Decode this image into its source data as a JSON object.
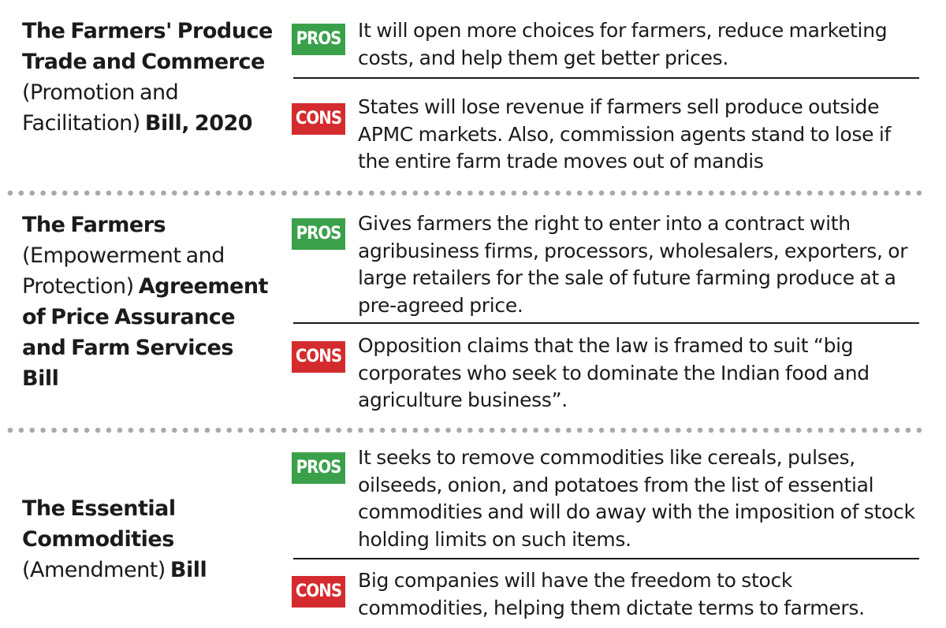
{
  "bills": [
    {
      "title_parts": [
        {
          "text": "The Farmers' Produce Trade and Commerce",
          "bold": true
        },
        {
          "text": " (Promotion and Facilitation) ",
          "bold": false
        },
        {
          "text": "Bill, 2020",
          "bold": true
        }
      ],
      "pros_label": "PROS",
      "pros_text": "It will open more choices for farmers, reduce marketing costs, and help them get better prices.",
      "cons_label": "CONS",
      "cons_text": "States will lose revenue if farmers sell produce outside APMC markets. Also, commission agents stand to lose if the entire farm trade moves out of mandis"
    },
    {
      "title_parts": [
        {
          "text": "The Farmers",
          "bold": true
        },
        {
          "text": " (Empowerment and Protection) ",
          "bold": false
        },
        {
          "text": "Agreement of Price Assurance and Farm Services Bill",
          "bold": true
        }
      ],
      "pros_label": "PROS",
      "pros_text": "Gives farmers the right to enter into a contract with agribusiness firms, processors, wholesalers, exporters, or large retailers for the sale of future farming produce at a pre-agreed price.",
      "cons_label": "CONS",
      "cons_text": "Opposition claims that the law is framed to suit “big corporates who seek to dominate the Indian food and agriculture business”."
    },
    {
      "title_parts": [
        {
          "text": "The Essential Commodities",
          "bold": true
        },
        {
          "text": " (Amendment) ",
          "bold": false
        },
        {
          "text": "Bill",
          "bold": true
        }
      ],
      "pros_label": "PROS",
      "pros_text": "It seeks to remove commodities like cereals, pulses, oilseeds, onion, and potatoes from the list of essential commodities and will do away with the imposition of stock holding limits on such items.",
      "cons_label": "CONS",
      "cons_text": "Big companies will have the freedom to stock commodities, helping them dictate terms to farmers."
    }
  ]
}
